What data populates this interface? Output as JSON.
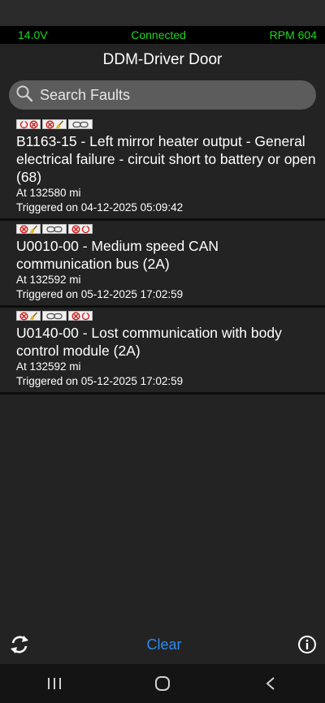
{
  "obd": {
    "voltage": "14.0V",
    "connection": "Connected",
    "rpm": "RPM 604"
  },
  "header": {
    "title": "DDM-Driver Door"
  },
  "search": {
    "placeholder": "Search Faults"
  },
  "faults": [
    {
      "badges": [
        [
          "pending-icon",
          "stop-icon"
        ],
        [
          "stop-icon",
          "broom-icon"
        ],
        [
          "chain-icon"
        ]
      ],
      "description": "B1163-15 - Left mirror heater output - General electrical failure - circuit short to battery or open (68)",
      "mileage": "At 132580 mi",
      "triggered": "Triggered on 04-12-2025 05:09:42"
    },
    {
      "badges": [
        [
          "stop-icon",
          "broom-icon"
        ],
        [
          "chain-icon"
        ],
        [
          "stop-icon",
          "pending-icon"
        ]
      ],
      "description": "U0010-00 - Medium speed CAN communication bus (2A)",
      "mileage": "At 132592 mi",
      "triggered": "Triggered on 05-12-2025 17:02:59"
    },
    {
      "badges": [
        [
          "stop-icon",
          "broom-icon"
        ],
        [
          "chain-icon"
        ],
        [
          "stop-icon",
          "pending-icon"
        ]
      ],
      "description": "U0140-00 - Lost communication with body control module (2A)",
      "mileage": "At 132592 mi",
      "triggered": "Triggered on 05-12-2025 17:02:59"
    }
  ],
  "footer": {
    "clear_label": "Clear",
    "refresh_icon": "refresh-icon",
    "info_icon": "info-icon"
  },
  "colors": {
    "accent": "#2b8cf0",
    "status_green": "#1ed61e",
    "background": "#232323"
  }
}
